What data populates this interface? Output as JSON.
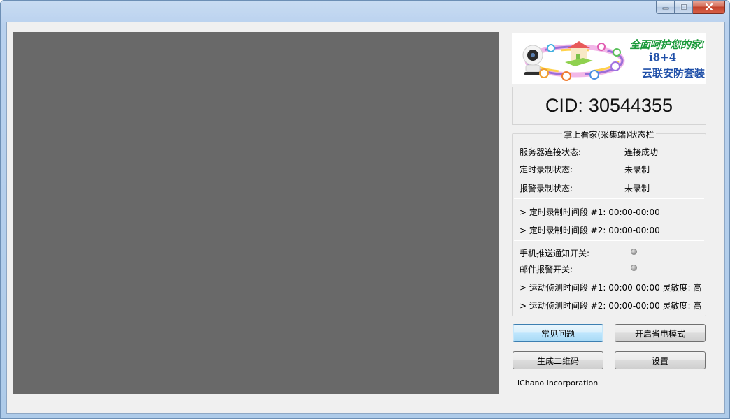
{
  "window": {
    "caption_buttons": {
      "minimize": "minimize-icon",
      "maximize": "maximize-icon",
      "close": "close-icon"
    }
  },
  "banner": {
    "slogan": "全面呵护您的家!",
    "model": "i8+4",
    "product": "云联安防套装"
  },
  "cid": {
    "label": "CID:",
    "value": "30544355"
  },
  "status_group": {
    "title": "掌上看家(采集端)状态栏",
    "rows": [
      {
        "label": "服务器连接状态:",
        "value": "连接成功"
      },
      {
        "label": "定时录制状态:",
        "value": "未录制"
      },
      {
        "label": "报警录制状态:",
        "value": "未录制"
      }
    ],
    "record_periods": [
      "> 定时录制时间段 #1: 00:00-00:00",
      "> 定时录制时间段 #2: 00:00-00:00"
    ],
    "switches": [
      {
        "label": "手机推送通知开关:",
        "state": "off"
      },
      {
        "label": "邮件报警开关:",
        "state": "off"
      }
    ],
    "motion_periods": [
      "> 运动侦测时间段 #1: 00:00-00:00  灵敏度: 高",
      "> 运动侦测时间段 #2: 00:00-00:00  灵敏度: 高"
    ]
  },
  "buttons": {
    "faq": "常见问题",
    "power_save": "开启省电模式",
    "qrcode": "生成二维码",
    "settings": "设置"
  },
  "footer": {
    "company": "iChano Incorporation"
  },
  "colors": {
    "video_bg": "#696969",
    "client_bg": "#f0f0f0",
    "banner_green": "#1a9a3a",
    "banner_blue": "#1f4fa8"
  }
}
